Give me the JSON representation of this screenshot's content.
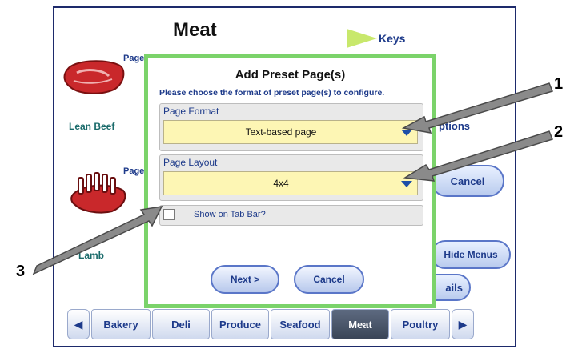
{
  "page": {
    "title": "Meat"
  },
  "keys": {
    "label": "Keys"
  },
  "left_items": [
    {
      "tag": "Page",
      "label": "Lean Beef"
    },
    {
      "tag": "Page",
      "label": "Lamb"
    }
  ],
  "right_side": {
    "options_partial": "ptions",
    "cancel_label": "Cancel",
    "hide_menus_label": "Hide Menus",
    "details_partial": "ails"
  },
  "tab_bar": {
    "tabs": [
      "Bakery",
      "Deli",
      "Produce",
      "Seafood",
      "Meat",
      "Poultry"
    ],
    "active": "Meat"
  },
  "dialog": {
    "title": "Add Preset Page(s)",
    "subtitle": "Please choose the format of preset page(s) to configure.",
    "page_format": {
      "label": "Page Format",
      "value": "Text-based page"
    },
    "page_layout": {
      "label": "Page Layout",
      "value": "4x4"
    },
    "show_on_tab_bar": {
      "label": "Show on Tab Bar?",
      "checked": false
    },
    "next_label": "Next >",
    "cancel_label": "Cancel"
  },
  "callouts": [
    "1",
    "2",
    "3"
  ],
  "colors": {
    "frame": "#1d2a6b",
    "dialog_border": "#7bd36a",
    "select_bg": "#fdf6b4",
    "accent": "#1d3a8a",
    "active_tab": "#3a4557"
  }
}
